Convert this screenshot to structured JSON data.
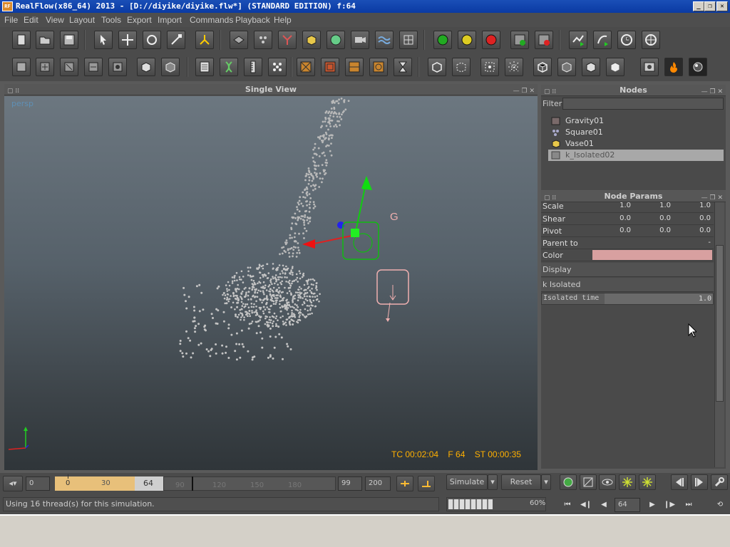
{
  "window": {
    "title": "RealFlow(x86_64) 2013 - [D://diyike/diyike.flw*] (STANDARD EDITION) f:64",
    "controls": [
      "_",
      "❐",
      "✕"
    ]
  },
  "menu": [
    "File",
    "Edit",
    "View",
    "Layout",
    "Tools",
    "Export",
    "Import",
    "Commands",
    "Playback",
    "Help"
  ],
  "viewport": {
    "panel_title": "Single View",
    "camera_label": "persp",
    "timecode": "TC 00:02:04",
    "frame": "F 64",
    "sim_time": "ST 00:00:35",
    "gizmo_label": "G"
  },
  "nodes": {
    "panel_title": "Nodes",
    "filter_label": "Filter",
    "filter_value": "",
    "items": [
      {
        "label": "Gravity01",
        "icon": "gravity-daemon-icon",
        "selected": false
      },
      {
        "label": "Square01",
        "icon": "square-emitter-icon",
        "selected": false
      },
      {
        "label": "Vase01",
        "icon": "object-icon",
        "selected": false
      },
      {
        "label": "k_Isolated02",
        "icon": "isolated-daemon-icon",
        "selected": true
      }
    ]
  },
  "node_params": {
    "panel_title": "Node Params",
    "rows": [
      {
        "label": "Scale",
        "values": [
          "1.0",
          "1.0",
          "1.0"
        ]
      },
      {
        "label": "Shear",
        "values": [
          "0.0",
          "0.0",
          "0.0"
        ]
      },
      {
        "label": "Pivot",
        "values": [
          "0.0",
          "0.0",
          "0.0"
        ]
      },
      {
        "label": "Parent to",
        "values": [
          "-"
        ]
      },
      {
        "label": "Color",
        "values": []
      }
    ],
    "color_swatch": "#d8a0a0",
    "section_display": "Display",
    "section_isolated": "k Isolated",
    "isolated_time_label": "Isolated time",
    "isolated_time_value": "1.0"
  },
  "timeline": {
    "start_field": "0",
    "range_start": "0",
    "tick_30": "30",
    "current_frame": "64",
    "ticks_dim": [
      "90",
      "120",
      "150",
      "180"
    ],
    "end_field": "99",
    "max_field": "200",
    "simulate_label": "Simulate",
    "reset_label": "Reset"
  },
  "status": {
    "message": "Using 16 thread(s) for this simulation.",
    "progress_percent": "60%",
    "frame_field": "64"
  },
  "colors": {
    "selected_row": "#a8a8a8",
    "timeline_range": "#e8c07a",
    "accent_orange": "#ffb000"
  }
}
